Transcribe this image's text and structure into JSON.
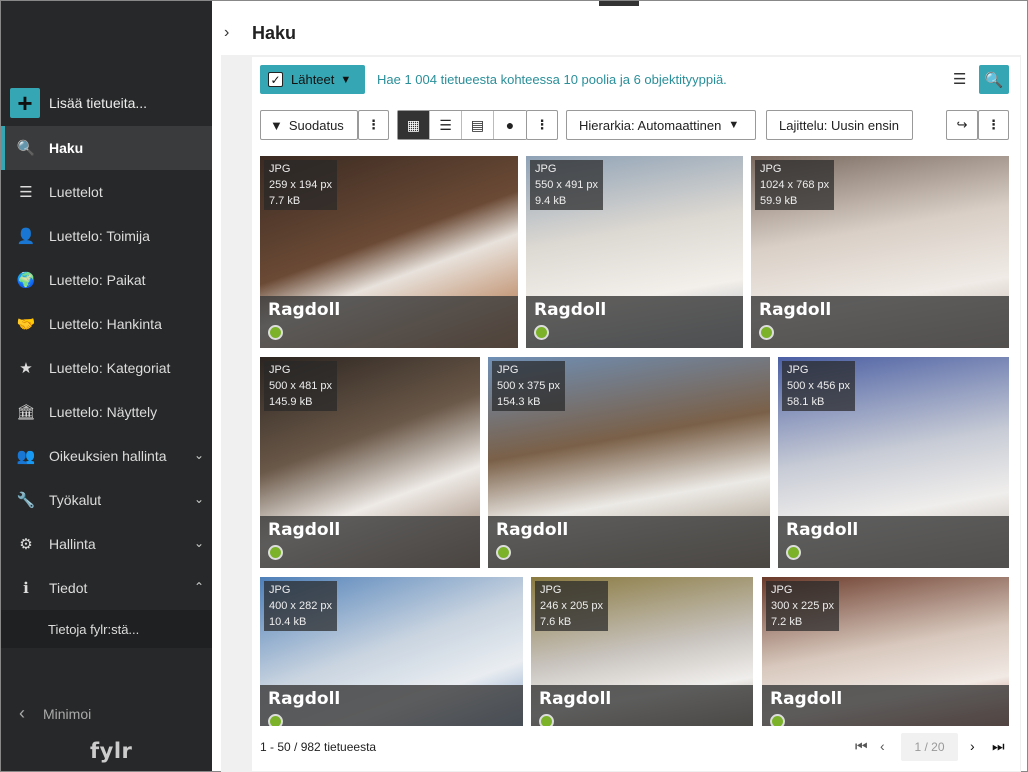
{
  "sidebar": {
    "add_label": "Lisää tietueita...",
    "items": [
      {
        "label": "Haku",
        "icon": "search-icon",
        "glyph": "🔍"
      },
      {
        "label": "Luettelot",
        "icon": "list-icon",
        "glyph": "☰"
      },
      {
        "label": "Luettelo: Toimija",
        "icon": "contact-card-icon",
        "glyph": "👤"
      },
      {
        "label": "Luettelo: Paikat",
        "icon": "globe-icon",
        "glyph": "🌍"
      },
      {
        "label": "Luettelo: Hankinta",
        "icon": "handshake-icon",
        "glyph": "🤝"
      },
      {
        "label": "Luettelo: Kategoriat",
        "icon": "star-icon",
        "glyph": "★"
      },
      {
        "label": "Luettelo: Näyttely",
        "icon": "museum-icon",
        "glyph": "🏛"
      },
      {
        "label": "Oikeuksien hallinta",
        "icon": "users-icon",
        "glyph": "👥"
      },
      {
        "label": "Työkalut",
        "icon": "wrench-icon",
        "glyph": "🔧"
      },
      {
        "label": "Hallinta",
        "icon": "gears-icon",
        "glyph": "⚙"
      },
      {
        "label": "Tiedot",
        "icon": "info-icon",
        "glyph": "ℹ"
      }
    ],
    "sub_item": "Tietoja fylr:stä...",
    "minimize_label": "Minimoi",
    "logo": "fylr"
  },
  "header": {
    "title": "Haku"
  },
  "search": {
    "sources_label": "Lähteet",
    "info_text": "Hae 1 004 tietueesta kohteessa 10 poolia ja 6 objektityyppiä."
  },
  "toolbar": {
    "filter_label": "Suodatus",
    "hierarchy_label": "Hierarkia: Automaattinen",
    "sort_label": "Lajittelu: Uusin ensin"
  },
  "tiles": [
    {
      "format": "JPG",
      "dims": "259 x 194 px",
      "size": "7.7 kB",
      "name": "Ragdoll"
    },
    {
      "format": "JPG",
      "dims": "550 x 491 px",
      "size": "9.4 kB",
      "name": "Ragdoll"
    },
    {
      "format": "JPG",
      "dims": "1024 x 768 px",
      "size": "59.9 kB",
      "name": "Ragdoll"
    },
    {
      "format": "JPG",
      "dims": "500 x 481 px",
      "size": "145.9 kB",
      "name": "Ragdoll"
    },
    {
      "format": "JPG",
      "dims": "500 x 375 px",
      "size": "154.3 kB",
      "name": "Ragdoll"
    },
    {
      "format": "JPG",
      "dims": "500 x 456 px",
      "size": "58.1 kB",
      "name": "Ragdoll"
    },
    {
      "format": "JPG",
      "dims": "400 x 282 px",
      "size": "10.4 kB",
      "name": "Ragdoll"
    },
    {
      "format": "JPG",
      "dims": "246 x 205 px",
      "size": "7.6 kB",
      "name": "Ragdoll"
    },
    {
      "format": "JPG",
      "dims": "300 x 225 px",
      "size": "7.2 kB",
      "name": "Ragdoll"
    }
  ],
  "footer": {
    "count_text": "1 - 50 / 982 tietueesta",
    "page_text": "1 / 20"
  },
  "colors": {
    "accent": "#35a6b3",
    "sidebar_bg": "#272829"
  }
}
